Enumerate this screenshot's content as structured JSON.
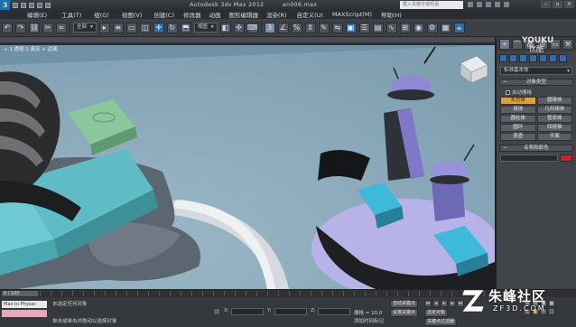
{
  "window": {
    "app_title": "Autodesk 3ds Max  2012",
    "file_name": "an006.max",
    "search_placeholder": "键入关键字或短语",
    "logo_letter": "3"
  },
  "menu": {
    "items": [
      "编辑(E)",
      "工具(T)",
      "组(G)",
      "视图(V)",
      "创建(C)",
      "修改器",
      "动画",
      "图形编辑器",
      "渲染(R)",
      "自定义(U)",
      "MAXScript(M)",
      "帮助(H)"
    ]
  },
  "toolbar": {
    "selection_filter": "全部",
    "reference_coord": "视图"
  },
  "viewport": {
    "label": "+ 1 透视 1 真实 + 边面"
  },
  "command_panel": {
    "tabs": [
      "+",
      "⌒",
      "品",
      "◎",
      "▭",
      "⚒"
    ],
    "category_dropdown": "标准基本体",
    "object_type_title": "对象类型",
    "autogrid_label": "自动栅格",
    "objects": [
      "长方体",
      "圆锥体",
      "球体",
      "几何球体",
      "圆柱体",
      "管状体",
      "圆环",
      "四棱锥",
      "茶壶",
      "平面"
    ],
    "active_object": "长方体",
    "name_color_title": "名称和颜色",
    "object_color": "#c1272d"
  },
  "timeline": {
    "frame_display": "0 / 100"
  },
  "status": {
    "maxscript_label": "Max to Physac",
    "selected_text": "未选定任何对象",
    "hint_text": "单击或单击并拖动以选择对象",
    "x_label": "X:",
    "y_label": "Y:",
    "z_label": "Z:",
    "grid_text": "栅格 = 10.0",
    "add_time_tag": "添加时间标记",
    "auto_key": "自动关键点",
    "selected_object": "选定对象",
    "set_key": "设置关键点",
    "key_filters": "关键点过滤器"
  },
  "watermark": {
    "youku": "YOUKU",
    "youku_sub": "优酷",
    "site_name": "朱峰社区",
    "site_url": "ZF3D.COM"
  }
}
